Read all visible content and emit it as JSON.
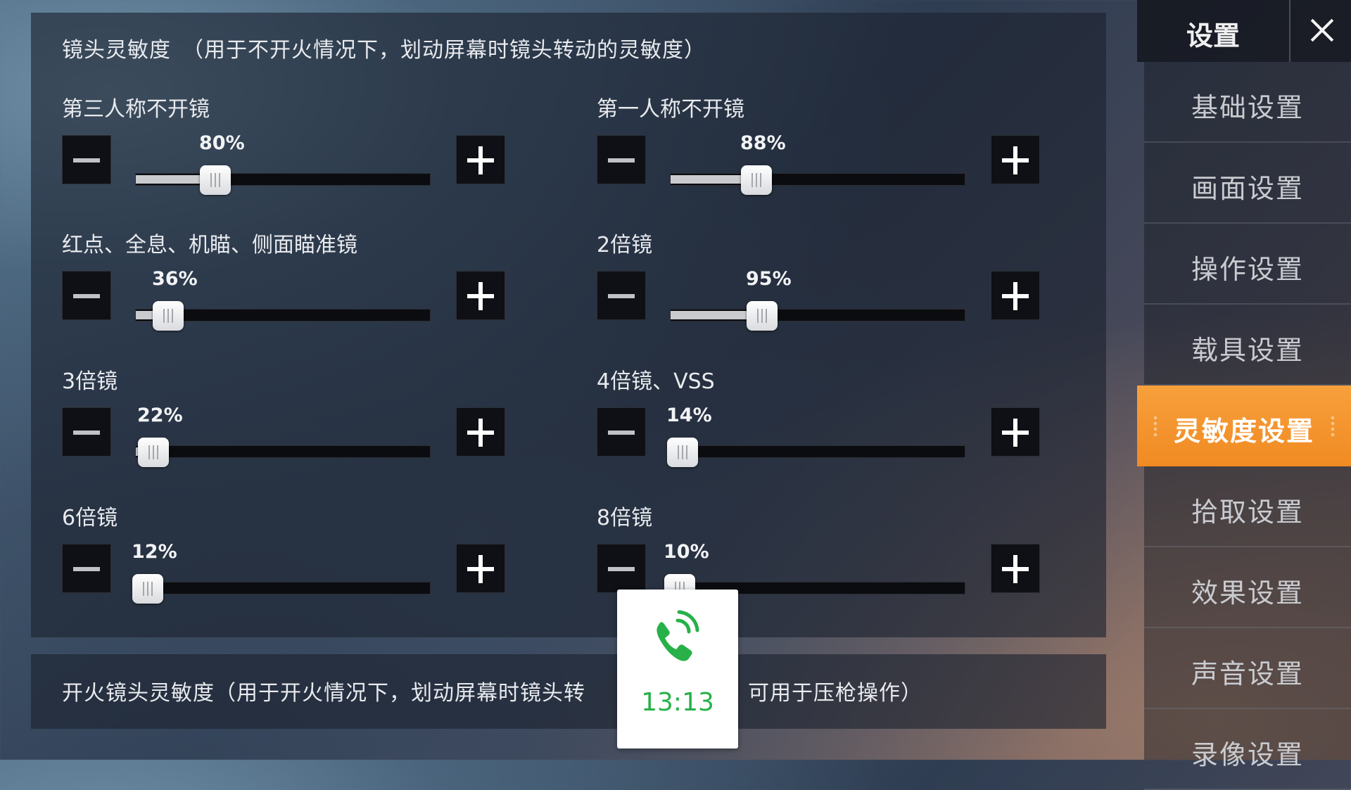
{
  "camera_panel": {
    "title": "镜头灵敏度　（用于不开火情况下，划动屏幕时镜头转动的灵敏度）",
    "settings": [
      {
        "label": "第三人称不开镜",
        "value": "80%",
        "level": 0.27
      },
      {
        "label": "第一人称不开镜",
        "value": "88%",
        "level": 0.29
      },
      {
        "label": "红点、全息、机瞄、侧面瞄准镜",
        "value": "36%",
        "level": 0.11
      },
      {
        "label": "2倍镜",
        "value": "95%",
        "level": 0.31
      },
      {
        "label": "3倍镜",
        "value": "22%",
        "level": 0.06
      },
      {
        "label": "4倍镜、VSS",
        "value": "14%",
        "level": 0.04
      },
      {
        "label": "6倍镜",
        "value": "12%",
        "level": 0.04
      },
      {
        "label": "8倍镜",
        "value": "10%",
        "level": 0.03
      }
    ]
  },
  "fire_panel": {
    "title_left": "开火镜头灵敏度（用于开火情况下，划动屏幕时镜头转",
    "title_right": "，可用于压枪操作）"
  },
  "sidebar": {
    "title": "设置",
    "items": [
      {
        "label": "基础设置",
        "active": false
      },
      {
        "label": "画面设置",
        "active": false
      },
      {
        "label": "操作设置",
        "active": false
      },
      {
        "label": "载具设置",
        "active": false
      },
      {
        "label": "灵敏度设置",
        "active": true
      },
      {
        "label": "拾取设置",
        "active": false
      },
      {
        "label": "效果设置",
        "active": false
      },
      {
        "label": "声音设置",
        "active": false
      },
      {
        "label": "录像设置",
        "active": false
      }
    ]
  },
  "call_overlay": {
    "time": "13:13",
    "icon": "phone-call-icon",
    "color": "#27b148"
  },
  "colors": {
    "accent": "#f18a22"
  }
}
